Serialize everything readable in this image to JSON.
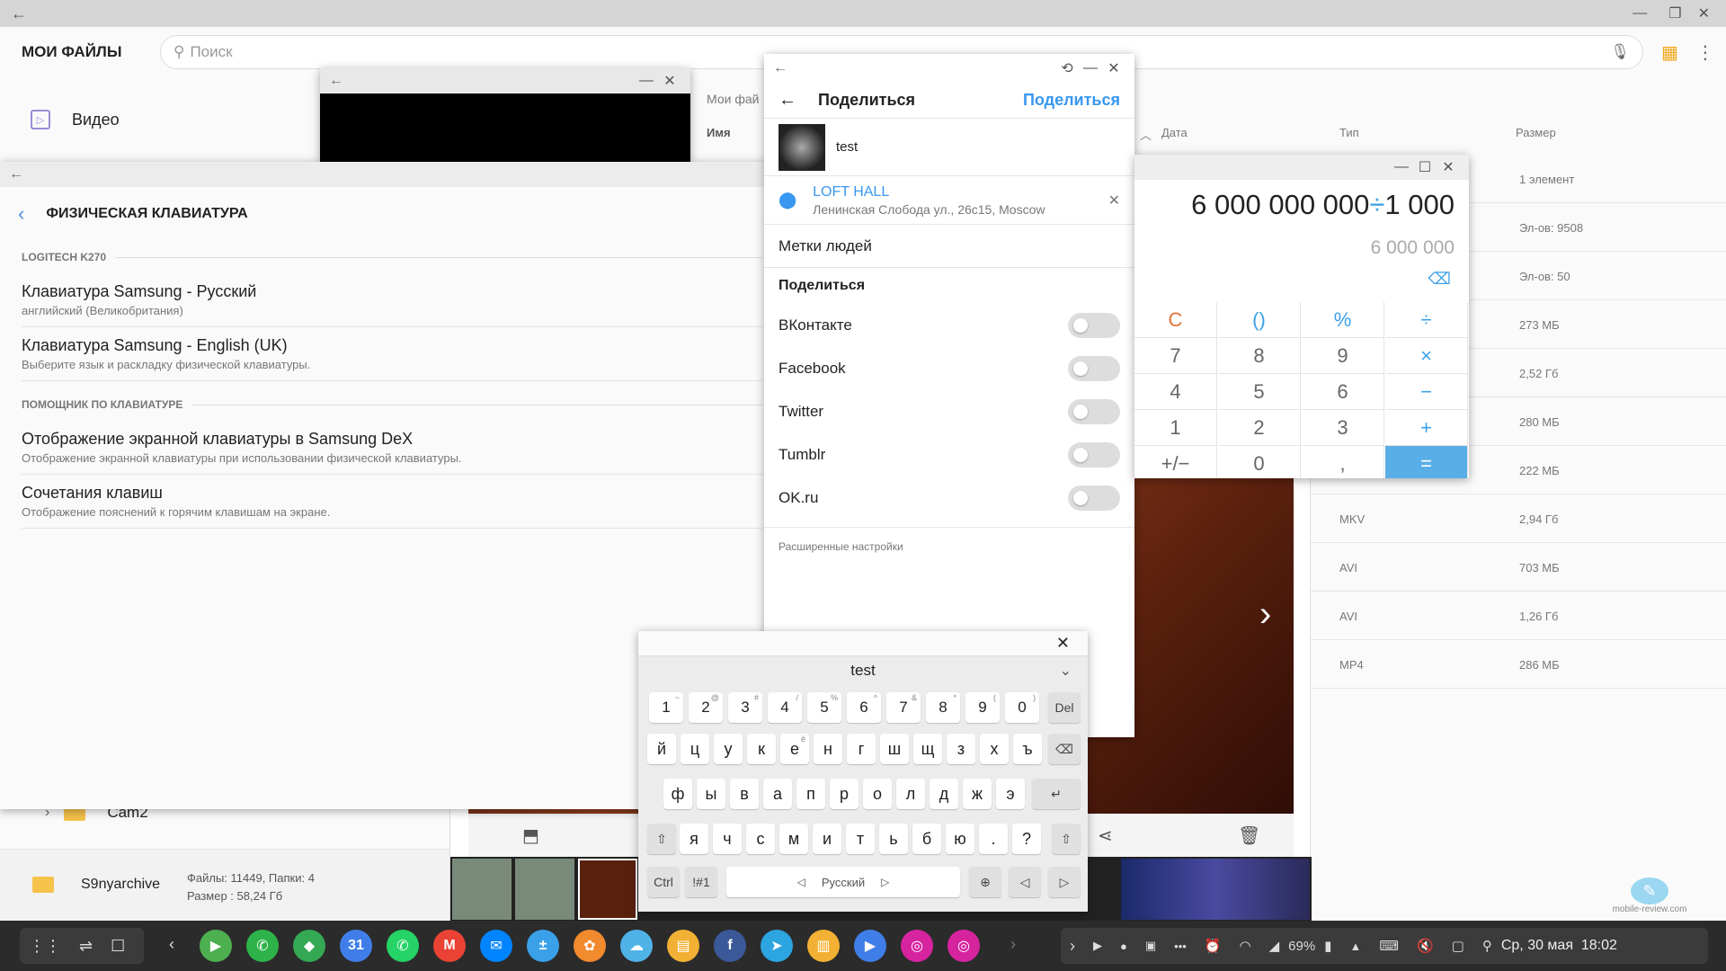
{
  "files": {
    "app_title": "МОИ ФАЙЛЫ",
    "search_placeholder": "Поиск",
    "sidebar_video": "Видео",
    "breadcrumb": "Мои фай",
    "col_name": "Имя",
    "col_date": "Дата",
    "col_type": "Тип",
    "col_size": "Размер",
    "rows": [
      {
        "type": "",
        "size": "1 элемент"
      },
      {
        "type": "",
        "size": "Эл-ов: 9508"
      },
      {
        "type": "",
        "size": "Эл-ов: 50"
      },
      {
        "type": "",
        "size": "273 МБ"
      },
      {
        "type": "",
        "size": "2,52 Гб"
      },
      {
        "type": "",
        "size": "280 МБ"
      },
      {
        "type": "",
        "size": "222 МБ"
      },
      {
        "type": "MKV",
        "size": "2,94 Гб"
      },
      {
        "type": "AVI",
        "size": "703 МБ"
      },
      {
        "type": "AVI",
        "size": "1,26 Гб"
      },
      {
        "type": "MP4",
        "size": "286 МБ"
      }
    ],
    "folder_cam2": "Cam2",
    "footer_folder": "S9nyarchive",
    "footer_counts": "Файлы: 11449, Папки: 4",
    "footer_size": "Размер : 58,24 Гб"
  },
  "kbset": {
    "title": "ФИЗИЧЕСКАЯ КЛАВИАТУРА",
    "section1": "LOGITECH K270",
    "items1": [
      {
        "title": "Клавиатура Samsung - Русский",
        "sub": "английский (Великобритания)"
      },
      {
        "title": "Клавиатура Samsung - English (UK)",
        "sub": "Выберите язык и раскладку физической клавиатуры."
      }
    ],
    "section2": "ПОМОЩНИК ПО КЛАВИАТУРЕ",
    "items2": [
      {
        "title": "Отображение экранной клавиатуры в Samsung DeX",
        "sub": "Отображение экранной клавиатуры при использовании физической клавиатуры."
      },
      {
        "title": "Сочетания клавиш",
        "sub": "Отображение пояснений к горячим клавишам на экране."
      }
    ]
  },
  "share": {
    "title": "Поделиться",
    "action": "Поделиться",
    "caption": "test",
    "location_name": "LOFT HALL",
    "location_addr": "Ленинская Слобода ул., 26с15, Moscow",
    "tag_people": "Метки людей",
    "share_section": "Поделиться",
    "networks": [
      "ВКонтакте",
      "Facebook",
      "Twitter",
      "Tumblr",
      "OK.ru"
    ],
    "advanced": "Расширенные настройки"
  },
  "calc": {
    "expression_a": "6 000 000 000",
    "expression_op": "÷",
    "expression_b": "1 000",
    "result": "6 000 000",
    "keys": [
      [
        "C",
        "()",
        "%",
        "÷"
      ],
      [
        "7",
        "8",
        "9",
        "×"
      ],
      [
        "4",
        "5",
        "6",
        "−"
      ],
      [
        "1",
        "2",
        "3",
        "+"
      ],
      [
        "+/−",
        "0",
        ",",
        "="
      ]
    ]
  },
  "keyboard": {
    "preview": "test",
    "numbers": [
      "1",
      "2",
      "3",
      "4",
      "5",
      "6",
      "7",
      "8",
      "9",
      "0"
    ],
    "number_alts": [
      "~",
      "@",
      "#",
      "/",
      "%",
      "^",
      "&",
      "*",
      "(",
      ")"
    ],
    "del": "Del",
    "row1": [
      "й",
      "ц",
      "у",
      "к",
      "е",
      "н",
      "г",
      "ш",
      "щ",
      "з",
      "х",
      "ъ"
    ],
    "row2": [
      "ф",
      "ы",
      "в",
      "а",
      "п",
      "р",
      "о",
      "л",
      "д",
      "ж",
      "э"
    ],
    "row3": [
      "я",
      "ч",
      "с",
      "м",
      "и",
      "т",
      "ь",
      "б",
      "ю",
      ".",
      "?"
    ],
    "e_alt": "ё",
    "ctrl": "Ctrl",
    "sym": "!#1",
    "space_label": "Русский"
  },
  "taskbar": {
    "battery": "69%",
    "datetime": "Ср, 30 мая  18:02",
    "apps": [
      {
        "name": "play-store-icon",
        "color": "#4caf50",
        "glyph": "▶"
      },
      {
        "name": "phone-icon",
        "color": "#2eb34a",
        "glyph": "✆"
      },
      {
        "name": "maps-icon",
        "color": "#34a853",
        "glyph": "◆"
      },
      {
        "name": "calendar-icon",
        "color": "#3f7ee8",
        "glyph": "31"
      },
      {
        "name": "whatsapp-icon",
        "color": "#25d366",
        "glyph": "✆"
      },
      {
        "name": "gmail-icon",
        "color": "#ea4335",
        "glyph": "M"
      },
      {
        "name": "messenger-icon",
        "color": "#0084ff",
        "glyph": "✉"
      },
      {
        "name": "calculator-icon",
        "color": "#3aa0e8",
        "glyph": "±"
      },
      {
        "name": "gallery-icon",
        "color": "#f28a2e",
        "glyph": "✿"
      },
      {
        "name": "weather-icon",
        "color": "#4fb3e8",
        "glyph": "☁"
      },
      {
        "name": "files-icon",
        "color": "#f2b134",
        "glyph": "▤"
      },
      {
        "name": "facebook-icon",
        "color": "#3b5998",
        "glyph": "f"
      },
      {
        "name": "telegram-icon",
        "color": "#2ca5e0",
        "glyph": "➤"
      },
      {
        "name": "folder-icon",
        "color": "#f2b134",
        "glyph": "▥"
      },
      {
        "name": "video-icon",
        "color": "#3f7ee8",
        "glyph": "▶"
      },
      {
        "name": "instagram-icon",
        "color": "#d6249f",
        "glyph": "◎"
      },
      {
        "name": "instagram-icon-2",
        "color": "#d6249f",
        "glyph": "◎"
      }
    ]
  },
  "watermark": "mobile-review.com"
}
